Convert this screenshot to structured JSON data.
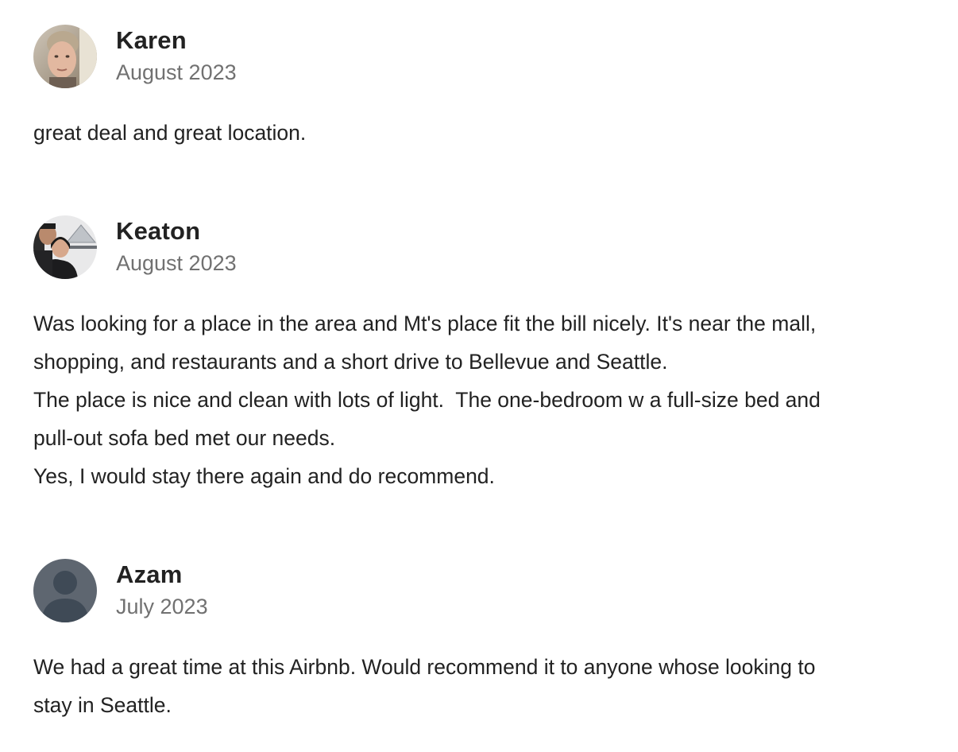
{
  "reviews": [
    {
      "name": "Karen",
      "date": "August 2023",
      "avatar": "photo-woman-portrait",
      "lines": [
        "great deal and great location."
      ]
    },
    {
      "name": "Keaton",
      "date": "August 2023",
      "avatar": "photo-couple-selfie",
      "lines": [
        "Was looking for a place in the area and Mt's place fit the bill nicely. It's near the mall,",
        "shopping, and restaurants and a short drive to Bellevue and Seattle.",
        "The place is nice and clean with lots of light.  The one-bedroom w a full-size bed and",
        "pull-out sofa bed met our needs.",
        "Yes, I would stay there again and do recommend."
      ]
    },
    {
      "name": "Azam",
      "date": "July 2023",
      "avatar": "default-user-silhouette",
      "lines": [
        "We had a great time at this Airbnb. Would recommend it to anyone whose looking to",
        "stay in Seattle."
      ]
    }
  ],
  "colors": {
    "text": "#222222",
    "secondary_text": "#717171",
    "default_avatar_bg": "#5e6670"
  }
}
